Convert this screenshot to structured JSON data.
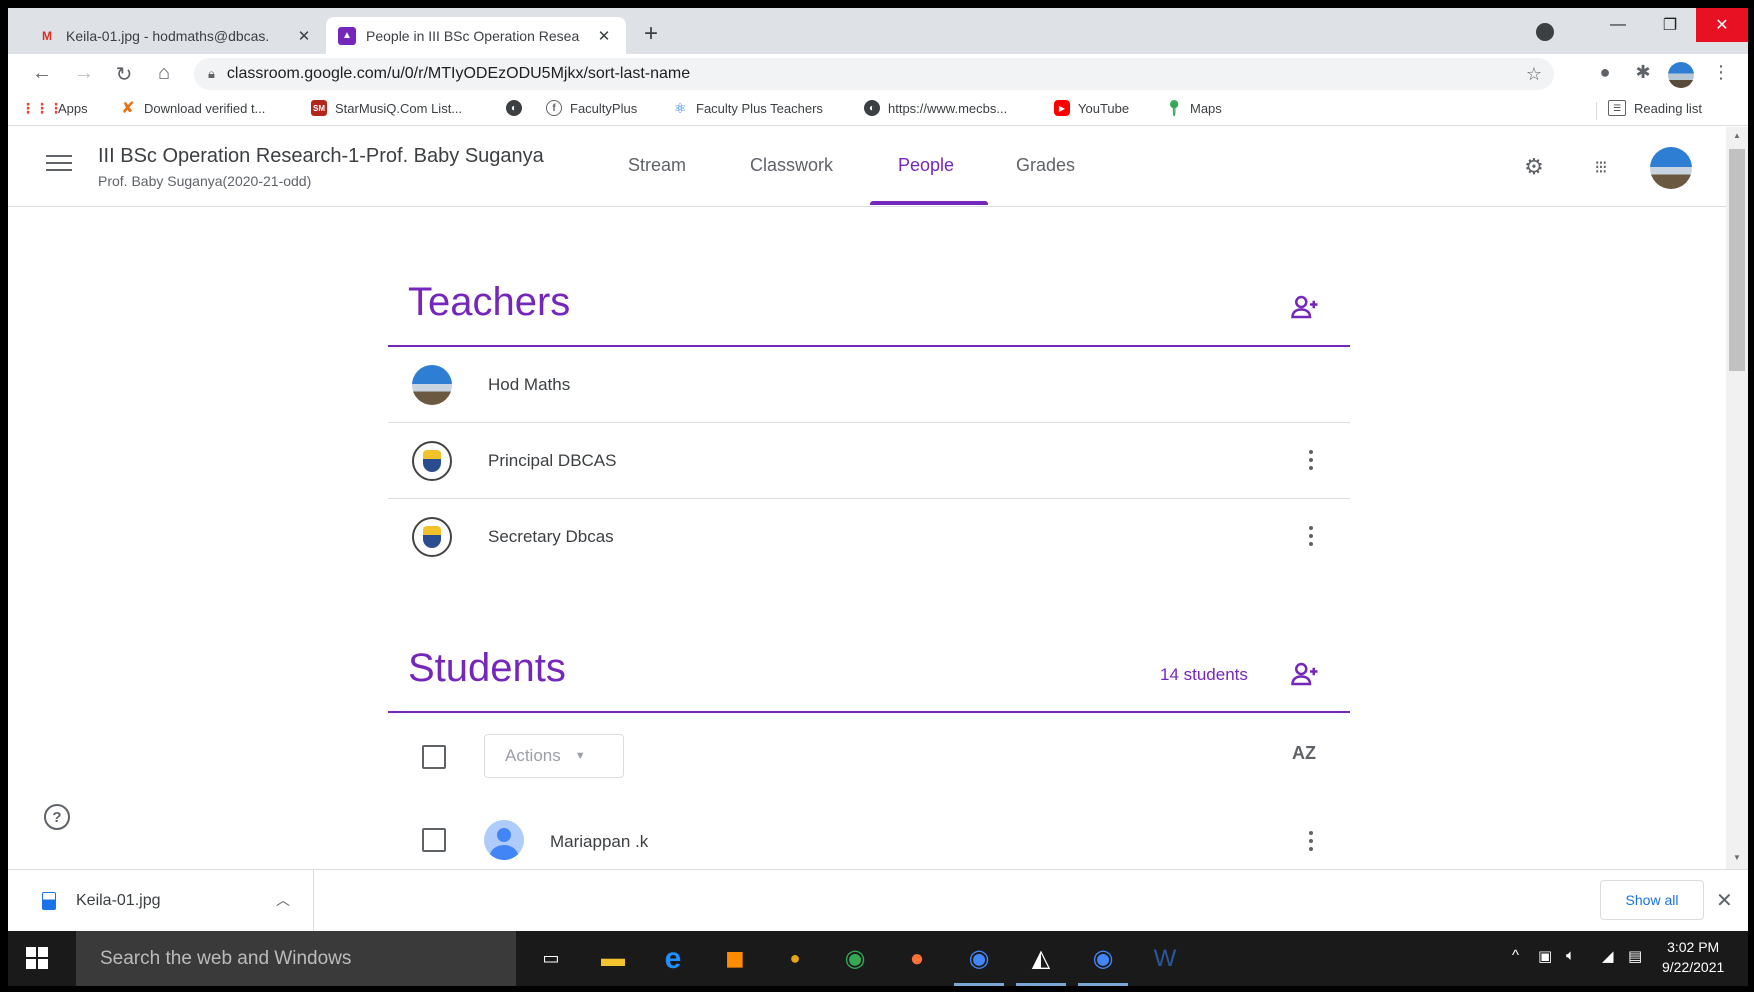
{
  "browser": {
    "tabs": [
      {
        "title": "Keila-01.jpg - hodmaths@dbcas.",
        "icon": "gmail-icon",
        "active": false
      },
      {
        "title": "People in III BSc Operation Resea",
        "icon": "classroom-icon",
        "active": true
      }
    ],
    "url": "classroom.google.com/u/0/r/MTIyODEzODU5Mjkx/sort-last-name",
    "bookmarks": [
      {
        "label": "Apps",
        "icon": "apps-grid-icon"
      },
      {
        "label": "Download verified t...",
        "icon": "x-icon"
      },
      {
        "label": "StarMusiQ.Com List...",
        "icon": "starmusiq-icon"
      },
      {
        "label": "",
        "icon": "globe-icon"
      },
      {
        "label": "FacultyPlus",
        "icon": "facultyplus-icon"
      },
      {
        "label": "Faculty Plus Teachers",
        "icon": "react-icon"
      },
      {
        "label": "https://www.mecbs...",
        "icon": "globe-icon"
      },
      {
        "label": "YouTube",
        "icon": "youtube-icon"
      },
      {
        "label": "Maps",
        "icon": "maps-icon"
      }
    ],
    "reading_list": "Reading list"
  },
  "classroom": {
    "class_title": "III BSc Operation Research-1-Prof. Baby Suganya",
    "class_subtitle": "Prof. Baby Suganya(2020-21-odd)",
    "nav_tabs": [
      "Stream",
      "Classwork",
      "People",
      "Grades"
    ],
    "active_tab": "People"
  },
  "teachers": {
    "heading": "Teachers",
    "list": [
      {
        "name": "Hod Maths",
        "has_menu": false
      },
      {
        "name": "Principal DBCAS",
        "has_menu": true
      },
      {
        "name": "Secretary Dbcas",
        "has_menu": true
      }
    ]
  },
  "students": {
    "heading": "Students",
    "count_label": "14 students",
    "actions_label": "Actions",
    "sort_label": "AZ",
    "list": [
      {
        "name": "Mariappan .k"
      }
    ]
  },
  "download_shelf": {
    "file_name": "Keila-01.jpg",
    "show_all": "Show all"
  },
  "taskbar": {
    "search_placeholder": "Search the web and Windows",
    "time": "3:02 PM",
    "date": "9/22/2021"
  },
  "colors": {
    "accent": "#7627bb",
    "close_red": "#e81123",
    "link_blue": "#1a73e8"
  }
}
